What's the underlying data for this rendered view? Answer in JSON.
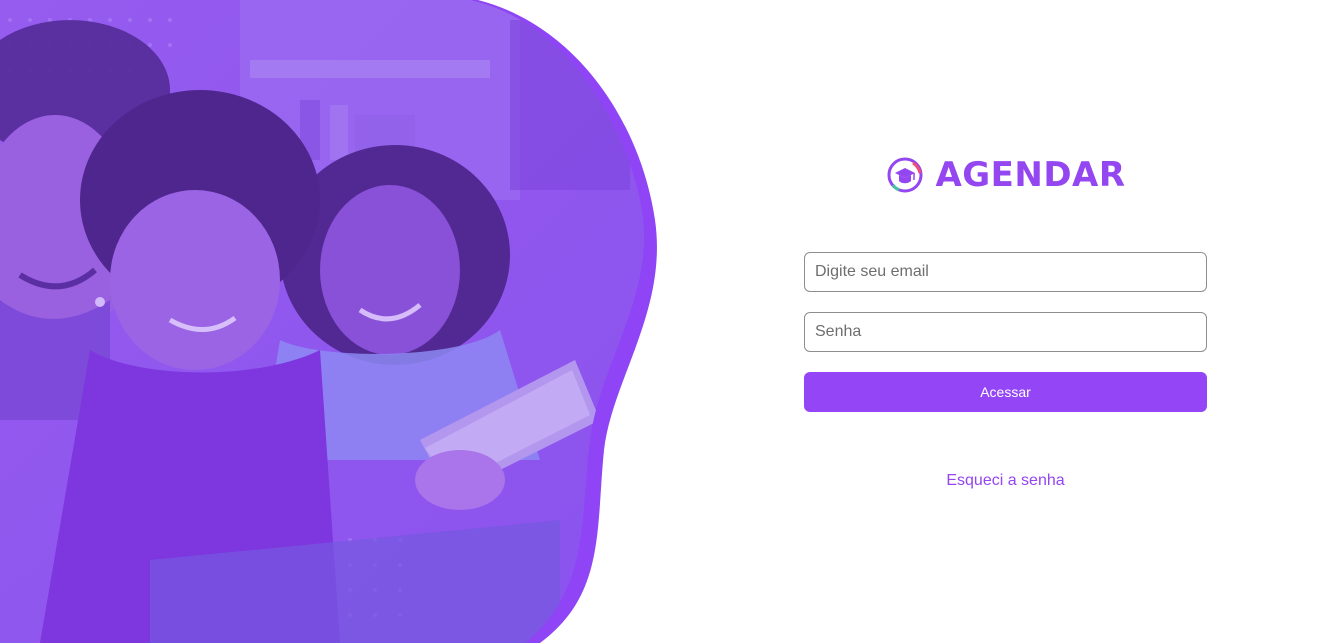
{
  "brand": {
    "name": "AGENDAR",
    "logo_icon": "graduation-cap-icon",
    "color": "#9446f0"
  },
  "hero": {
    "image_icon": "family-with-tablet-photo",
    "overlay_color": "#8a4cf0",
    "wave_color": "#8f44f5"
  },
  "form": {
    "email_placeholder": "Digite seu email",
    "email_value": "",
    "password_placeholder": "Senha",
    "password_value": "",
    "submit_label": "Acessar",
    "forgot_label": "Esqueci a senha",
    "accent_color": "#9446f7"
  }
}
